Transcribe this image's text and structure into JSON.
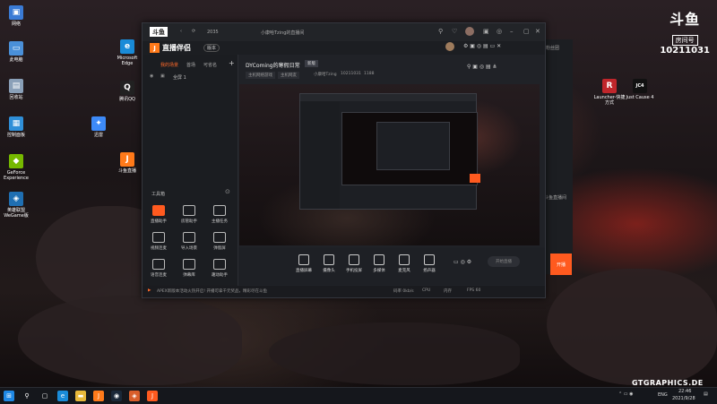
{
  "desktop": {
    "icons_left": [
      {
        "label": "网络",
        "icon": "network-icon",
        "color": "#3a7bd5",
        "glyph": "▣"
      },
      {
        "label": "此电脑",
        "icon": "computer-icon",
        "color": "#4a90d9",
        "glyph": "▭"
      },
      {
        "label": "回收站",
        "icon": "recycle-bin-icon",
        "color": "#8aa0b8",
        "glyph": "▤"
      },
      {
        "label": "控制面板",
        "icon": "control-panel-icon",
        "color": "#2f8fd8",
        "glyph": "▦"
      },
      {
        "label": "GeForce Experience",
        "icon": "geforce-icon",
        "color": "#76b900",
        "glyph": "◆"
      },
      {
        "label": "英雄联盟 WeGame版",
        "icon": "wegame-icon",
        "color": "#1f6fb2",
        "glyph": "◈"
      }
    ],
    "icons_col2": [
      {
        "label": "Microsoft Edge",
        "icon": "edge-icon",
        "color": "#1a8bd8",
        "glyph": "e"
      },
      {
        "label": "腾讯QQ",
        "icon": "qq-icon",
        "color": "#222",
        "glyph": "Q"
      },
      {
        "label": "迅雷",
        "icon": "xunlei-icon",
        "color": "#3d8af7",
        "glyph": "✦"
      },
      {
        "label": "斗鱼直播",
        "icon": "douyu-icon",
        "color": "#ff7a1a",
        "glyph": "J"
      }
    ],
    "icons_right": [
      {
        "label": "Launcher-快捷方式",
        "icon": "launcher-icon",
        "color": "#c0262b",
        "glyph": "R"
      },
      {
        "label": "Just Cause 4",
        "icon": "just-cause-icon",
        "color": "#111",
        "glyph": "JC4"
      }
    ]
  },
  "watermark": {
    "brand": "斗鱼",
    "room_label": "房间号",
    "room_number": "10211031"
  },
  "app": {
    "title_bar": {
      "user": "小康哈Tzing的直播间",
      "logo": "斗鱼",
      "nav_text": "2035"
    },
    "logo_text": "直播伴侣",
    "version_badge": "版本",
    "left_tabs": [
      "我的场景",
      "首场",
      "可省名"
    ],
    "add_scene": "+",
    "scene_item": "全屏 1",
    "toolbox_title": "工具箱",
    "tools": [
      {
        "label": "直播助手",
        "icon": "live-assistant-icon",
        "accent": "#ff5a1f"
      },
      {
        "label": "房管助手",
        "icon": "room-admin-icon",
        "accent": "#888"
      },
      {
        "label": "主播任务",
        "icon": "anchor-task-icon",
        "accent": "#888"
      },
      {
        "label": "视频连麦",
        "icon": "video-link-icon",
        "accent": "#888"
      },
      {
        "label": "导入场景",
        "icon": "import-scene-icon",
        "accent": "#888"
      },
      {
        "label": "弹窗屏",
        "icon": "popup-icon",
        "accent": "#888"
      },
      {
        "label": "语音连麦",
        "icon": "voice-link-icon",
        "accent": "#888"
      },
      {
        "label": "弹幕库",
        "icon": "danmu-icon",
        "accent": "#888"
      },
      {
        "label": "趣动助手",
        "icon": "fun-icon",
        "accent": "#888"
      }
    ],
    "stream_title": "DYComing的寒假日常",
    "stream_badge": "新版",
    "stream_tags": [
      "主机网络游戏",
      "主机网友"
    ],
    "stream_meta": [
      "小康哈Tzing",
      "10211031",
      "1188"
    ],
    "controls": [
      {
        "label": "直播屏幕",
        "icon": "screen-icon"
      },
      {
        "label": "摄像头",
        "icon": "camera-icon"
      },
      {
        "label": "手机投屏",
        "icon": "phone-cast-icon"
      },
      {
        "label": "多媒体",
        "icon": "media-icon"
      },
      {
        "label": "麦克风",
        "icon": "mic-icon"
      },
      {
        "label": "扬声器",
        "icon": "speaker-icon"
      }
    ],
    "go_live": "开始直播",
    "go_live_short": "开播",
    "notice_text": "APEX新版本活动火热开启! 开播可拿千元奖品，精彩尽在斗鱼",
    "status_items": [
      "码率 0kb/s",
      "CPU",
      "内存",
      "FPS 60"
    ]
  },
  "side_panel": {
    "title": "粉丝团",
    "item": "斗鱼直播间"
  },
  "taskbar": {
    "items": [
      {
        "icon": "start-icon",
        "glyph": "⊞",
        "color": "#1e88e5"
      },
      {
        "icon": "search-icon",
        "glyph": "⚲",
        "color": "#15171c"
      },
      {
        "icon": "task-view-icon",
        "glyph": "▢",
        "color": "#15171c"
      },
      {
        "icon": "edge-taskbar-icon",
        "glyph": "e",
        "color": "#1a8bd8"
      },
      {
        "icon": "explorer-icon",
        "glyph": "▬",
        "color": "#e7b83a"
      },
      {
        "icon": "douyu-taskbar-icon",
        "glyph": "J",
        "color": "#ff7a1a"
      },
      {
        "icon": "steam-icon",
        "glyph": "◉",
        "color": "#1b2838"
      },
      {
        "icon": "app-taskbar-icon",
        "glyph": "◈",
        "color": "#d95e2a"
      },
      {
        "icon": "live-taskbar-icon",
        "glyph": "J",
        "color": "#ff5a1f"
      }
    ],
    "lang": "ENG",
    "time": "22:46",
    "date": "2021/9/28",
    "brand_watermark": "GTGRAPHICS.DE"
  }
}
